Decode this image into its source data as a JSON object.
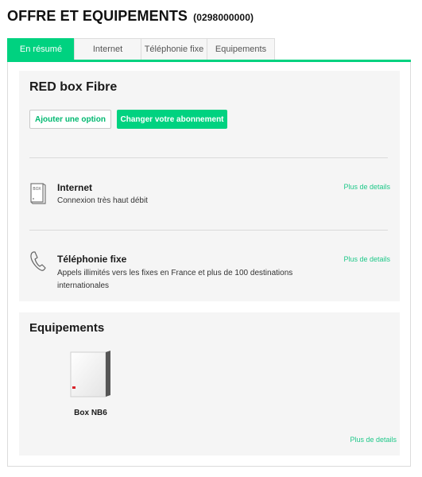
{
  "header": {
    "title": "OFFRE ET EQUIPEMENTS",
    "phone": "(0298000000)"
  },
  "tabs": [
    {
      "label": "En résumé",
      "active": true
    },
    {
      "label": "Internet",
      "active": false
    },
    {
      "label": "Téléphonie fixe",
      "active": false
    },
    {
      "label": "Equipements",
      "active": false
    }
  ],
  "offer": {
    "title": "RED box Fibre",
    "add_option_label": "Ajouter une option",
    "change_subscription_label": "Changer votre abonnement",
    "services": [
      {
        "name": "Internet",
        "description": "Connexion très haut débit",
        "details_label": "Plus de details",
        "icon": "box-router-icon"
      },
      {
        "name": "Téléphonie fixe",
        "description": "Appels illimités vers les fixes en France et plus de 100 destinations internationales",
        "details_label": "Plus de details",
        "icon": "phone-handset-icon"
      }
    ]
  },
  "equipment": {
    "title": "Equipements",
    "items": [
      {
        "name": "Box NB6",
        "icon": "box-nb6-image"
      }
    ],
    "details_label": "Plus de details"
  },
  "colors": {
    "accent": "#00d280",
    "link": "#1fc889",
    "card_bg": "#f5f5f5"
  }
}
